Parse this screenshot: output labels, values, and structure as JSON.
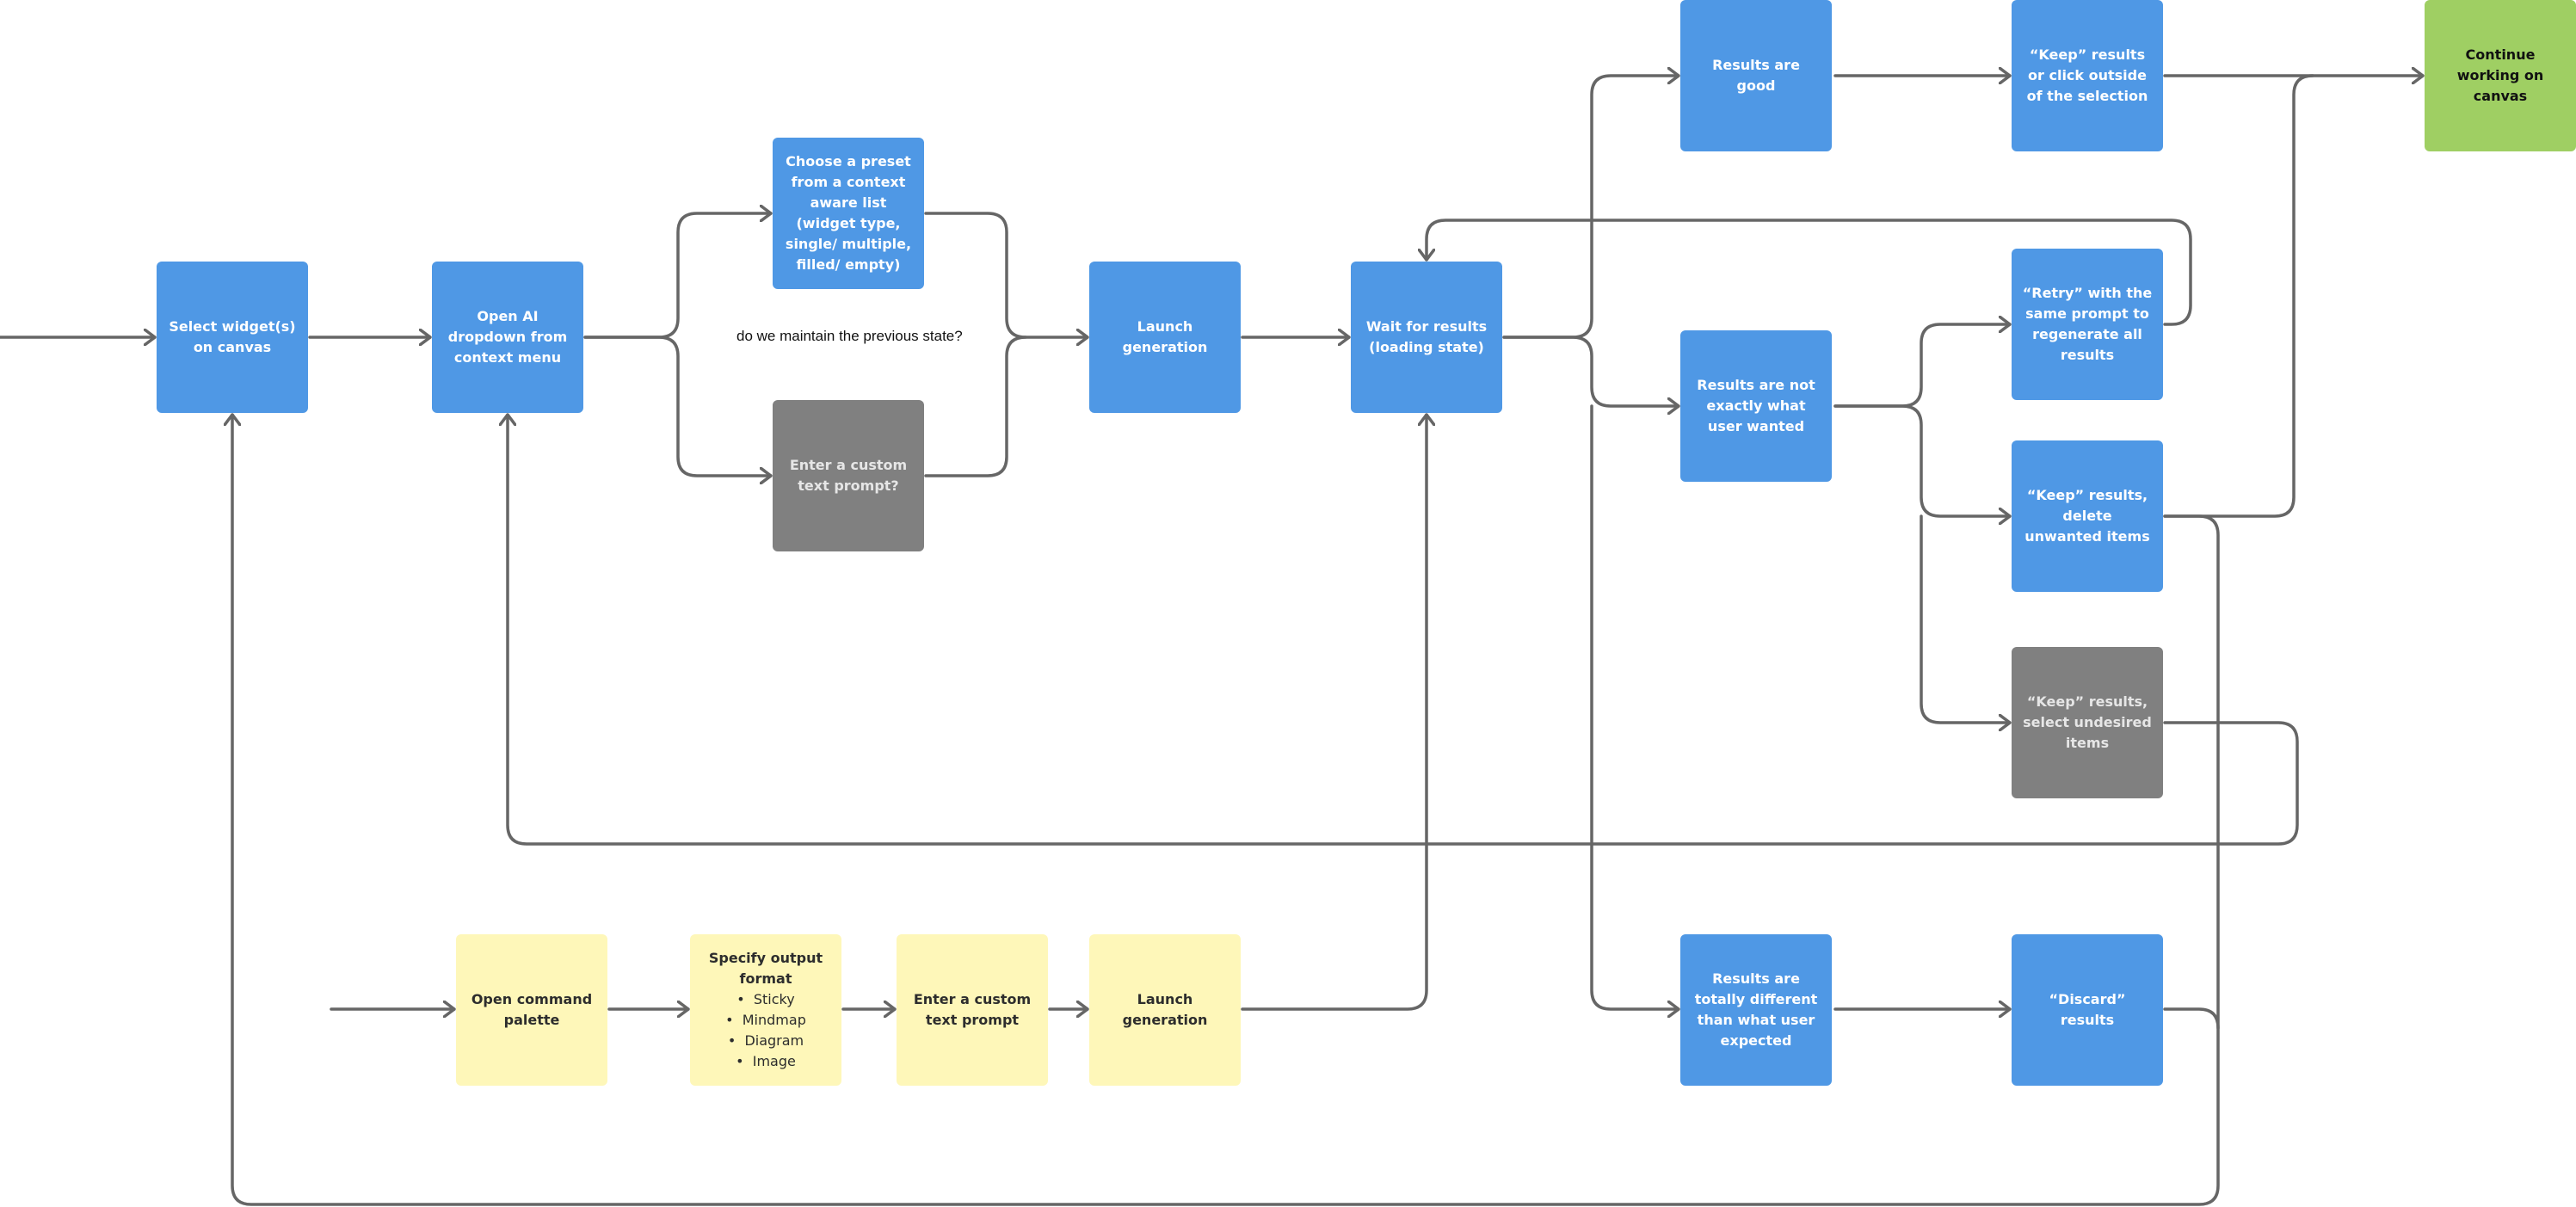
{
  "diagram": {
    "type": "flowchart",
    "colors": {
      "primary_step": "#4f98e5",
      "alternative_step": "#808080",
      "end_state": "#9fcf63",
      "command_palette_flow": "#fef7b9",
      "connector": "#666666"
    },
    "nodes": {
      "select_widgets": {
        "label": "Select widget(s) on canvas",
        "kind": "blue"
      },
      "open_ai_dropdown": {
        "label": "Open AI dropdown from context menu",
        "kind": "blue"
      },
      "choose_preset": {
        "label": "Choose a preset from a context aware list (widget type, single/ multiple, filled/ empty)",
        "kind": "blue"
      },
      "custom_prompt_question": {
        "label": "Enter a custom text prompt?",
        "kind": "gray"
      },
      "launch_generation": {
        "label": "Launch generation",
        "kind": "blue"
      },
      "wait_results": {
        "label": "Wait for results (loading state)",
        "kind": "blue"
      },
      "results_good": {
        "label": "Results are good",
        "kind": "blue"
      },
      "keep_or_click_outside": {
        "label": "“Keep” results or click outside of the selection",
        "kind": "blue"
      },
      "continue_working": {
        "label": "Continue working on canvas",
        "kind": "green"
      },
      "results_not_exact": {
        "label": "Results are not exactly what user wanted",
        "kind": "blue"
      },
      "retry_same_prompt": {
        "label": "“Retry” with the same prompt to regenerate all results",
        "kind": "blue"
      },
      "keep_delete_unwanted": {
        "label": "“Keep” results, delete unwanted items",
        "kind": "blue"
      },
      "keep_select_undesired": {
        "label": "“Keep” results, select undesired items",
        "kind": "gray"
      },
      "results_totally_different": {
        "label": "Results are totally different than what user expected",
        "kind": "blue"
      },
      "discard_results": {
        "label": "“Discard” results",
        "kind": "blue"
      },
      "open_command_palette": {
        "label": "Open command palette",
        "kind": "yellow"
      },
      "specify_output_format": {
        "label": "Specify output format",
        "kind": "yellow",
        "options": [
          "Sticky",
          "Mindmap",
          "Diagram",
          "Image"
        ]
      },
      "enter_custom_prompt": {
        "label": "Enter a custom text prompt",
        "kind": "yellow"
      },
      "launch_generation_palette": {
        "label": "Launch generation",
        "kind": "yellow"
      }
    },
    "annotations": {
      "maintain_state": "do we maintain the previous state?"
    },
    "edges": [
      [
        "entry",
        "select_widgets"
      ],
      [
        "select_widgets",
        "open_ai_dropdown"
      ],
      [
        "open_ai_dropdown",
        "choose_preset"
      ],
      [
        "open_ai_dropdown",
        "custom_prompt_question"
      ],
      [
        "choose_preset",
        "launch_generation"
      ],
      [
        "custom_prompt_question",
        "launch_generation"
      ],
      [
        "launch_generation",
        "wait_results"
      ],
      [
        "wait_results",
        "results_good"
      ],
      [
        "wait_results",
        "results_not_exact"
      ],
      [
        "wait_results",
        "results_totally_different"
      ],
      [
        "results_good",
        "keep_or_click_outside"
      ],
      [
        "keep_or_click_outside",
        "continue_working"
      ],
      [
        "results_not_exact",
        "retry_same_prompt"
      ],
      [
        "results_not_exact",
        "keep_delete_unwanted"
      ],
      [
        "results_not_exact",
        "keep_select_undesired"
      ],
      [
        "retry_same_prompt",
        "wait_results"
      ],
      [
        "keep_delete_unwanted",
        "continue_working"
      ],
      [
        "keep_delete_unwanted",
        "select_widgets"
      ],
      [
        "keep_select_undesired",
        "open_ai_dropdown"
      ],
      [
        "results_totally_different",
        "discard_results"
      ],
      [
        "discard_results",
        "select_widgets"
      ],
      [
        "palette_entry",
        "open_command_palette"
      ],
      [
        "open_command_palette",
        "specify_output_format"
      ],
      [
        "specify_output_format",
        "enter_custom_prompt"
      ],
      [
        "enter_custom_prompt",
        "launch_generation_palette"
      ],
      [
        "launch_generation_palette",
        "wait_results"
      ]
    ]
  }
}
